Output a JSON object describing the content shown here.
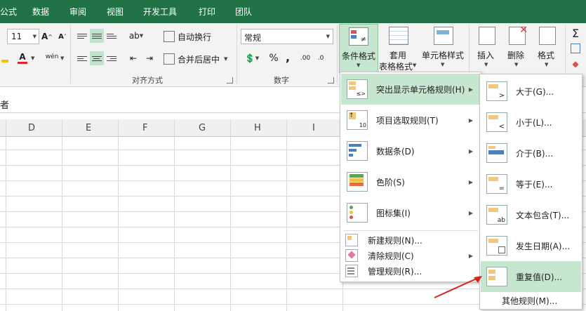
{
  "ribbon_tabs": [
    "公式",
    "数据",
    "审阅",
    "视图",
    "开发工具",
    "打印",
    "团队"
  ],
  "font": {
    "size": "11"
  },
  "alignment": {
    "wrap_text": "自动换行",
    "merge_center": "合并后居中",
    "group_label": "对齐方式"
  },
  "number": {
    "format_value": "常规",
    "percent": "%",
    "comma": ",",
    "group_label": "数字"
  },
  "styles": {
    "conditional_format": "条件格式",
    "table_format_line1": "套用",
    "table_format_line2": "表格格式",
    "cell_styles": "单元格样式"
  },
  "cells": {
    "insert": "插入",
    "delete": "删除",
    "format": "格式"
  },
  "formula_bar": {
    "content": "者"
  },
  "columns": [
    "D",
    "E",
    "F",
    "G",
    "H",
    "I"
  ],
  "cf_menu": {
    "items": [
      {
        "label": "突出显示单元格规则(H)",
        "icon": "highlight-rules-icon",
        "selected": true,
        "submenu": true
      },
      {
        "label": "项目选取规则(T)",
        "icon": "top-bottom-rules-icon",
        "selected": false,
        "submenu": true
      },
      {
        "label": "数据条(D)",
        "icon": "data-bars-icon",
        "selected": false,
        "submenu": true
      },
      {
        "label": "色阶(S)",
        "icon": "color-scales-icon",
        "selected": false,
        "submenu": true
      },
      {
        "label": "图标集(I)",
        "icon": "icon-sets-icon",
        "selected": false,
        "submenu": true
      }
    ],
    "small_items": [
      {
        "label": "新建规则(N)...",
        "icon": "new-rule-icon",
        "submenu": false
      },
      {
        "label": "清除规则(C)",
        "icon": "clear-rules-icon",
        "submenu": true
      },
      {
        "label": "管理规则(R)...",
        "icon": "manage-rules-icon",
        "submenu": false
      }
    ]
  },
  "sub_menu": {
    "items": [
      {
        "label": "大于(G)...",
        "symbol": ">"
      },
      {
        "label": "小于(L)...",
        "symbol": "<"
      },
      {
        "label": "介于(B)...",
        "symbol": ""
      },
      {
        "label": "等于(E)...",
        "symbol": "="
      },
      {
        "label": "文本包含(T)...",
        "symbol": "ab"
      },
      {
        "label": "发生日期(A)...",
        "symbol": "cal"
      },
      {
        "label": "重复值(D)...",
        "symbol": ""
      }
    ],
    "more": "其他规则(M)..."
  },
  "colors": {
    "accent": "#217346",
    "selected": "#c6e6d0",
    "icon_orange": "#f0c878"
  }
}
